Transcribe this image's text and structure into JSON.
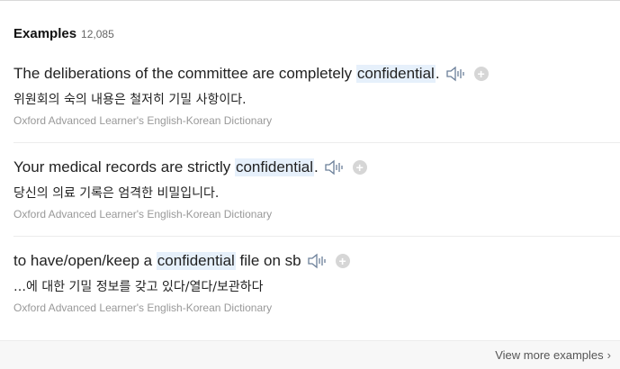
{
  "header": {
    "title": "Examples",
    "count": "12,085"
  },
  "examples": [
    {
      "before": "The deliberations of the committee are completely ",
      "highlight": "confidential",
      "after": ".",
      "translation": "위원회의 숙의 내용은 철저히 기밀 사항이다.",
      "source": "Oxford Advanced Learner's English-Korean Dictionary"
    },
    {
      "before": "Your medical records are strictly ",
      "highlight": "confidential",
      "after": ".",
      "translation": "당신의 의료 기록은 엄격한 비밀입니다.",
      "source": "Oxford Advanced Learner's English-Korean Dictionary"
    },
    {
      "before": "to have/open/keep a ",
      "highlight": "confidential",
      "after": " file on sb",
      "translation": "…에 대한 기밀 정보를 갖고 있다/열다/보관하다",
      "source": "Oxford Advanced Learner's English-Korean Dictionary"
    }
  ],
  "footer": {
    "view_more": "View more examples"
  },
  "icons": {
    "speaker": "speaker-icon",
    "add": "plus-circle-icon",
    "chevron": "chevron-right-icon"
  },
  "colors": {
    "highlight": "#e6f0fb",
    "muted": "#999999",
    "plus": "#d6d6d6"
  }
}
